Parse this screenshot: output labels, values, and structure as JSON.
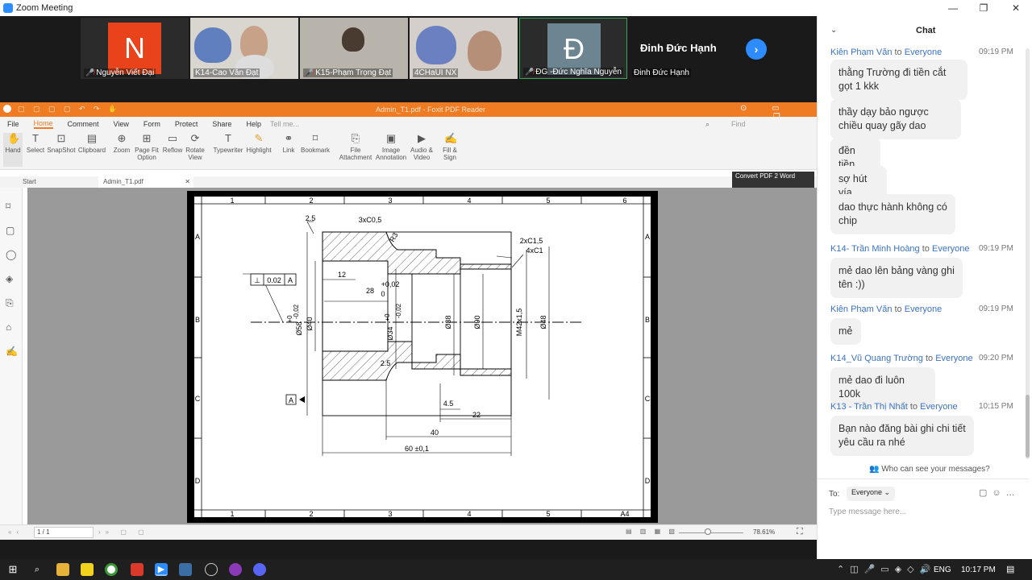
{
  "zoom": {
    "window_title": "Zoom Meeting",
    "participants": [
      {
        "name": "Nguyễn Viết Đại",
        "initial": "N",
        "color": "#e8431a",
        "muted": true
      },
      {
        "name": "K14-Cao Văn Đạt",
        "muted": false
      },
      {
        "name": "K15-Phạm Trọng Đạt",
        "muted": true
      },
      {
        "name": "4CHaUI NX",
        "muted": false
      },
      {
        "name": "ĐG -Đức Nghĩa Nguyễn",
        "initial": "Đ",
        "color": "#6d8590",
        "muted": true
      },
      {
        "name": "Đinh Đức Hạnh",
        "muted": false,
        "big_name": "Đinh Đức Hạnh"
      }
    ]
  },
  "foxit": {
    "title": "Admin_T1.pdf - Foxit PDF Reader",
    "menu": [
      "File",
      "Home",
      "Comment",
      "View",
      "Form",
      "Protect",
      "Share",
      "Help"
    ],
    "tell_me": "Tell me...",
    "find": "Find",
    "tools": [
      {
        "label": "Hand"
      },
      {
        "label": "Select"
      },
      {
        "label": "SnapShot"
      },
      {
        "label": "Clipboard"
      },
      {
        "label": "Zoom"
      },
      {
        "label": "Page Fit Option"
      },
      {
        "label": "Reflow"
      },
      {
        "label": "Rotate View"
      },
      {
        "label": "Typewriter"
      },
      {
        "label": "Highlight"
      },
      {
        "label": "Link"
      },
      {
        "label": "Bookmark"
      },
      {
        "label": "File Attachment"
      },
      {
        "label": "Image Annotation"
      },
      {
        "label": "Audio & Video"
      },
      {
        "label": "Fill & Sign"
      }
    ],
    "convert": "Convert PDF 2 Word",
    "tabs": [
      "Start",
      "Admin_T1.pdf"
    ],
    "page_indicator": "1 / 1",
    "zoom_level": "78.61%",
    "drawing": {
      "col_labels": [
        "1",
        "2",
        "3",
        "4",
        "5",
        "6"
      ],
      "row_labels": [
        "A",
        "B",
        "C",
        "D"
      ],
      "bottom_labels": [
        "1",
        "2",
        "3",
        "4",
        "5",
        "A4"
      ],
      "dims": {
        "d58": "Ø58",
        "tol58a": "+0",
        "tol58b": "-0,02",
        "d40": "Ø40",
        "d34": "Ø34",
        "tol34a": "+0",
        "tol34b": "-0,02",
        "d38": "Ø38",
        "d90": "Ø90",
        "m42": "M42x1,5",
        "d48": "Ø48",
        "c1": "3xC0,5",
        "c2": "2xC1,5",
        "c3": "4xC1",
        "r3": "R3",
        "w25a": "2.5",
        "w25b": "2.5",
        "w12": "12",
        "w28": "28",
        "t28a": "+0,02",
        "t28b": "0",
        "w45": "4.5",
        "w22": "22",
        "w40": "40",
        "w60": "60  ±0,1",
        "gdt_sym": "⊥",
        "gdt_val": "0.02",
        "gdt_ref": "A",
        "datum": "A"
      }
    }
  },
  "chat": {
    "title": "Chat",
    "messages": [
      {
        "from": "Kiên Phạm Văn",
        "to": "to",
        "target": "Everyone",
        "time": "09:19 PM",
        "bubbles": [
          "thằng Trường đi tiền cắt gọt 1 kkk",
          "thầy dạy bảo ngược chiều quay gãy dao",
          "đền tiền",
          "sợ hút vía",
          "dao thực hành không có chip"
        ]
      },
      {
        "from": "K14- Trần Minh Hoàng",
        "to": "to",
        "target": "Everyone",
        "time": "09:19 PM",
        "bubbles": [
          "mẻ dao lên bảng vàng ghi tên :))"
        ]
      },
      {
        "from": "Kiên Phạm Văn",
        "to": "to",
        "target": "Everyone",
        "time": "09:19 PM",
        "bubbles": [
          "mẻ"
        ]
      },
      {
        "from": "K14_Vũ Quang Trường",
        "to": "to",
        "target": "Everyone",
        "time": "09:20 PM",
        "bubbles": [
          "mẻ dao đi luôn 100k"
        ]
      },
      {
        "from": "K13 - Trần Thị Nhất",
        "to": "to",
        "target": "Everyone",
        "time": "10:15 PM",
        "bubbles": [
          "Bạn nào đăng bài ghi chi tiết yêu cầu ra nhé"
        ]
      }
    ],
    "who_can_see": "Who can see your messages?",
    "to_label": "To:",
    "to_value": "Everyone",
    "placeholder": "Type message here..."
  },
  "taskbar": {
    "lang": "ENG",
    "time": "10:17 PM"
  }
}
